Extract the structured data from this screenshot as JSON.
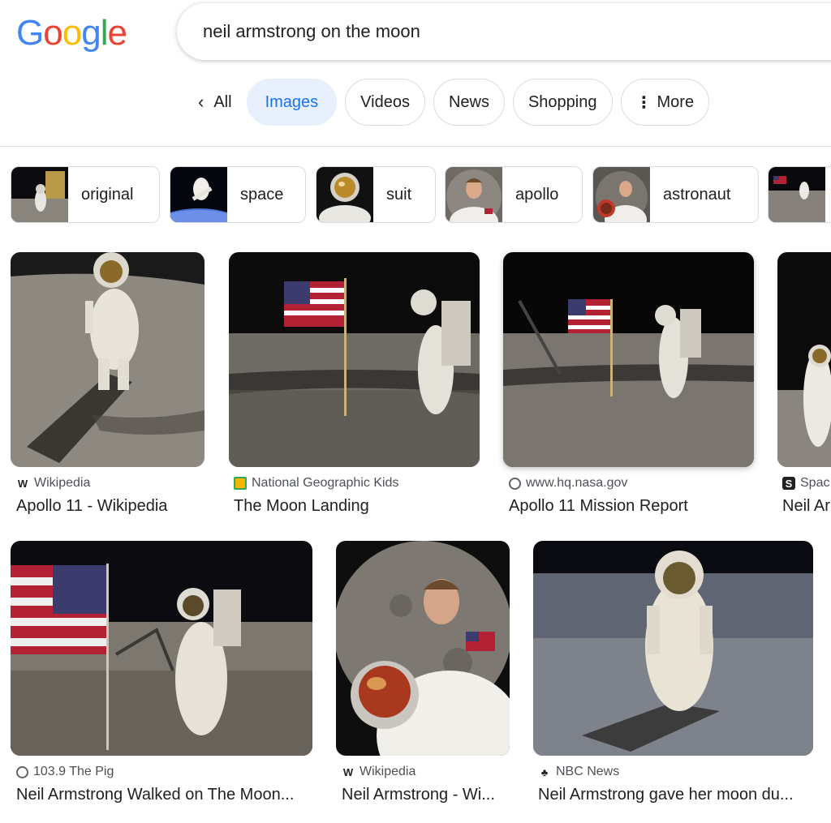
{
  "logo": {
    "letters": [
      "G",
      "o",
      "o",
      "g",
      "l",
      "e"
    ],
    "colors": [
      "#4285F4",
      "#EA4335",
      "#FBBC05",
      "#4285F4",
      "#34A853",
      "#EA4335"
    ]
  },
  "search": {
    "query": "neil armstrong on the moon"
  },
  "tabs": {
    "back": "All",
    "images": "Images",
    "videos": "Videos",
    "news": "News",
    "shopping": "Shopping",
    "more": "More"
  },
  "chips": [
    {
      "label": "original"
    },
    {
      "label": "space"
    },
    {
      "label": "suit"
    },
    {
      "label": "apollo"
    },
    {
      "label": "astronaut"
    }
  ],
  "results": [
    {
      "source": "Wikipedia",
      "favicon": "W",
      "title": "Apollo 11 - Wikipedia"
    },
    {
      "source": "National Geographic Kids",
      "favicon": "natgeo-icon",
      "title": "The Moon Landing"
    },
    {
      "source": "www.hq.nasa.gov",
      "favicon": "globe-icon",
      "title": "Apollo 11 Mission Report"
    },
    {
      "source": "Spac",
      "favicon": "S",
      "title": "Neil Ar"
    },
    {
      "source": "103.9 The Pig",
      "favicon": "globe-icon",
      "title": "Neil Armstrong Walked on The Moon..."
    },
    {
      "source": "Wikipedia",
      "favicon": "W",
      "title": "Neil Armstrong - Wi..."
    },
    {
      "source": "NBC News",
      "favicon": "nbc-peacock-icon",
      "title": "Neil Armstrong gave her moon du..."
    }
  ],
  "colors": {
    "accent": "#1a73e8",
    "active_tab_bg": "#e8f0fe"
  }
}
